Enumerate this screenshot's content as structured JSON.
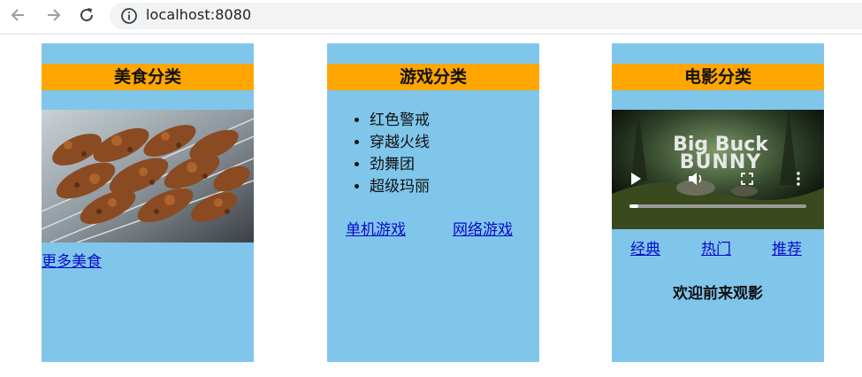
{
  "browser": {
    "url": "localhost:8080",
    "icons": [
      "back-arrow-icon",
      "forward-arrow-icon",
      "reload-icon",
      "info-icon"
    ]
  },
  "panels": {
    "food": {
      "title": "美食分类",
      "more_link": "更多美食",
      "image": "grilled-skewers-photo"
    },
    "games": {
      "title": "游戏分类",
      "items": [
        "红色警戒",
        "穿越火线",
        "劲舞团",
        "超级玛丽"
      ],
      "links": [
        "单机游戏",
        "网络游戏"
      ]
    },
    "movies": {
      "title": "电影分类",
      "video_title_line1": "Big Buck",
      "video_title_line2": "BUNNY",
      "links": [
        "经典",
        "热门",
        "推荐"
      ],
      "welcome": "欢迎前来观影"
    }
  },
  "colors": {
    "panel_bg": "#80c6eb",
    "title_bg": "#ffa600",
    "link": "#0a0acb"
  }
}
